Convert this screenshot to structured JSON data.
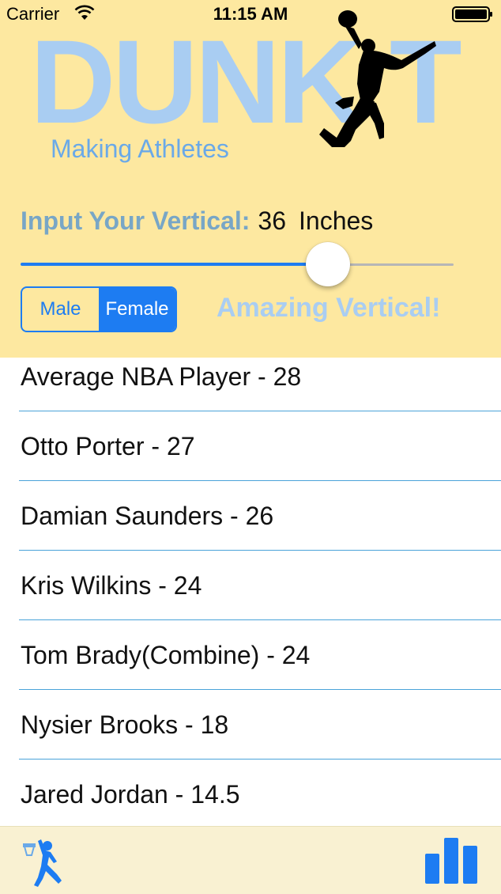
{
  "status_bar": {
    "carrier": "Carrier",
    "time": "11:15 AM"
  },
  "header": {
    "logo": "DUNK T",
    "tagline": "Making Athletes",
    "vertical_label": "Input Your Vertical:",
    "vertical_value": "36",
    "vertical_unit": "Inches",
    "slider_fraction": 0.71,
    "gender_options": [
      "Male",
      "Female"
    ],
    "gender_selected": "Female",
    "rating": "Amazing Vertical!"
  },
  "list": {
    "items": [
      "Average NBA Player - 28",
      "Otto Porter - 27",
      "Damian Saunders - 26",
      "Kris Wilkins - 24",
      "Tom Brady(Combine) - 24",
      "Nysier Brooks - 18",
      "Jared Jordan - 14.5"
    ]
  },
  "tabbar": {
    "tabs": [
      "player-icon",
      "chart-icon"
    ]
  },
  "colors": {
    "accent": "#1d7cf2",
    "header_bg": "#fde8a0",
    "logo": "#a9cdf2",
    "divider": "#4aa3d9"
  }
}
